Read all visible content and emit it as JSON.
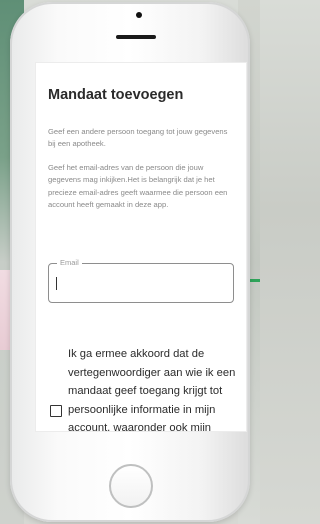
{
  "page": {
    "title": "Mandaat toevoegen",
    "intro": "Geef een andere persoon toegang tot jouw gegevens bij een apotheek.",
    "instructions": "Geef het email-adres van de persoon die jouw gegevens mag inkijken.Het is belangrijk dat je het precieze email-adres geeft waarmee die persoon een account heeft gemaakt in deze app."
  },
  "email_field": {
    "label": "Email",
    "value": ""
  },
  "consent": {
    "checked": false,
    "text": "Ik ga ermee akkoord dat de vertegenwoordiger aan wie ik een mandaat geef toegang krijgt tot persoonlijke informatie in mijn account, waaronder ook mijn aankoopgeschiedenis en medicatieschema"
  },
  "colors": {
    "accent": "#2fa45a",
    "text": "#2b2b2b",
    "muted": "#8a8a8a"
  }
}
